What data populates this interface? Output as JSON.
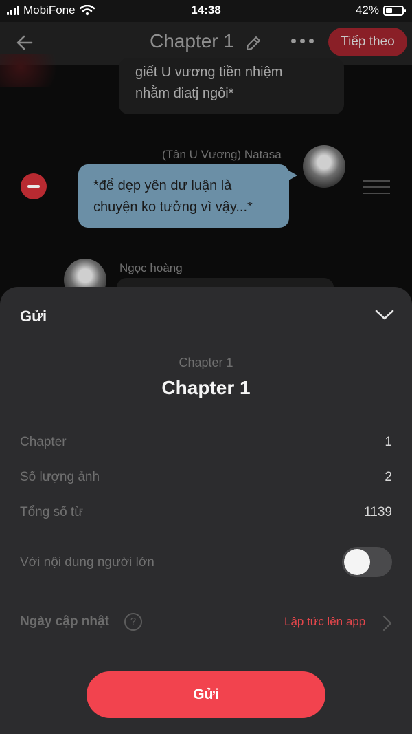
{
  "status_bar": {
    "carrier": "MobiFone",
    "time": "14:38",
    "battery_text": "42%",
    "battery_level": 0.42
  },
  "editor": {
    "title": "Chapter 1",
    "next_label": "Tiếp theo",
    "messages": [
      {
        "sender": "",
        "text_lines": [
          "giết U vương tiền nhiệm",
          "nhằm điatj ngôi*"
        ]
      },
      {
        "sender": "(Tân U Vương) Natasa",
        "text_lines": [
          "*để dẹp yên dư luận là",
          "chuyện ko tưởng vì vậy...*"
        ]
      },
      {
        "sender": "Ngọc hoàng",
        "text_lines": []
      }
    ]
  },
  "sheet": {
    "header": "Gửi",
    "subtitle": "Chapter 1",
    "title": "Chapter 1",
    "rows": [
      {
        "label": "Chapter",
        "value": "1"
      },
      {
        "label": "Số lượng ảnh",
        "value": "2"
      },
      {
        "label": "Tổng số từ",
        "value": "1139"
      }
    ],
    "adult_label": "Với nội dung người lớn",
    "adult_enabled": false,
    "update_label": "Ngày cập nhật",
    "help_symbol": "?",
    "update_value": "Lập tức lên app",
    "submit_label": "Gửi"
  },
  "colors": {
    "accent": "#f2434e",
    "link": "#e3464b",
    "sheet_bg": "#2c2c2e",
    "bubble_blue": "#6b8fa6"
  },
  "icons": [
    "wifi-icon",
    "back-arrow-icon",
    "pencil-icon",
    "more-icon",
    "menu-icon",
    "chevron-down-icon",
    "help-icon",
    "chevron-right-icon"
  ]
}
